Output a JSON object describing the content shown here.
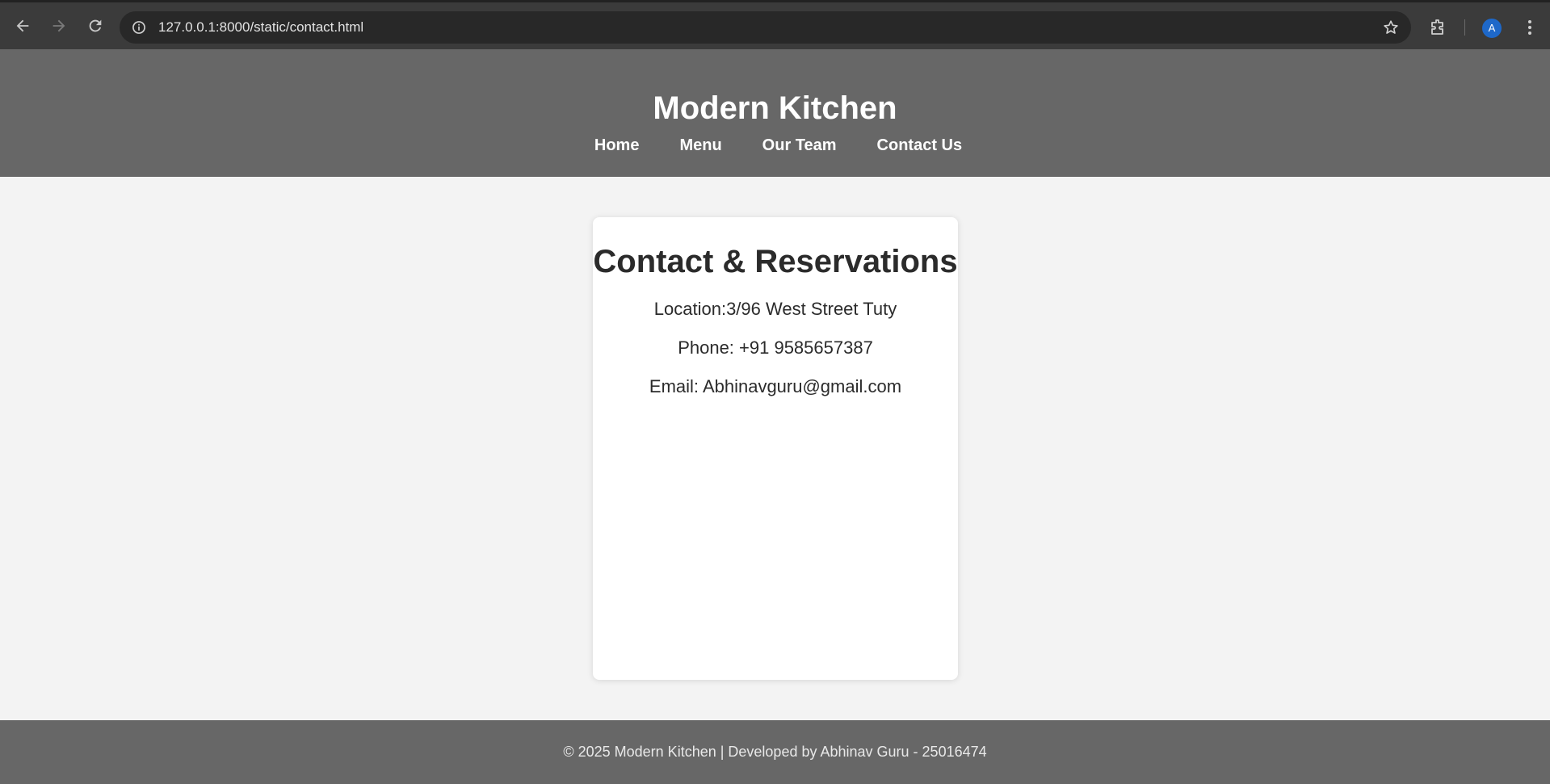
{
  "browser": {
    "url": "127.0.0.1:8000/static/contact.html",
    "profile_initial": "A",
    "profile_color": "#1e68c9"
  },
  "header": {
    "title": "Modern Kitchen",
    "nav": [
      {
        "label": "Home"
      },
      {
        "label": "Menu"
      },
      {
        "label": "Our Team"
      },
      {
        "label": "Contact Us"
      }
    ],
    "background": "#676767"
  },
  "contact": {
    "heading": "Contact & Reservations",
    "location": "Location:3/96 West Street Tuty",
    "phone": "Phone: +91 9585657387",
    "email": "Email: Abhinavguru@gmail.com"
  },
  "footer": {
    "text": "© 2025 Modern Kitchen | Developed by Abhinav Guru - 25016474"
  },
  "icons": [
    "back-icon",
    "forward-icon",
    "reload-icon",
    "site-info-icon",
    "bookmark-star-icon",
    "extensions-icon",
    "menu-kebab-icon"
  ]
}
